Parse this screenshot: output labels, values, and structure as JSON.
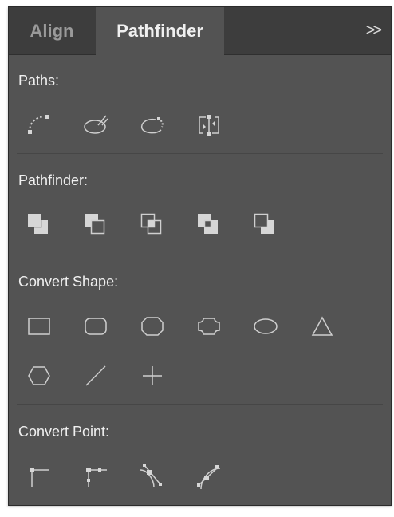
{
  "tabs": [
    {
      "label": "Align",
      "active": false
    },
    {
      "label": "Pathfinder",
      "active": true
    }
  ],
  "expand_label": ">>",
  "sections": {
    "paths": {
      "title": "Paths:"
    },
    "pathfinder": {
      "title": "Pathfinder:"
    },
    "convert_shape": {
      "title": "Convert Shape:"
    },
    "convert_point": {
      "title": "Convert Point:"
    }
  },
  "icons": {
    "paths": [
      "join-icon",
      "close-path-icon",
      "open-path-icon",
      "reverse-path-direction-icon"
    ],
    "pathfinder": [
      "unite-icon",
      "minus-front-icon",
      "intersect-icon",
      "exclude-icon",
      "minus-back-icon"
    ],
    "convert_shape": [
      "rectangle-icon",
      "rounded-rectangle-icon",
      "octagon-icon",
      "inverse-rounded-rectangle-icon",
      "ellipse-icon",
      "triangle-icon",
      "hexagon-icon",
      "line-icon",
      "plus-icon"
    ],
    "convert_point": [
      "corner-point-icon",
      "corner-point-handles-icon",
      "smooth-point-icon",
      "smooth-point-curve-icon"
    ]
  },
  "colors": {
    "panel_bg": "#535353",
    "tabbar_bg": "#3d3d3d",
    "icon_stroke": "#cfcfcf",
    "icon_fill": "#d6d6d6"
  }
}
